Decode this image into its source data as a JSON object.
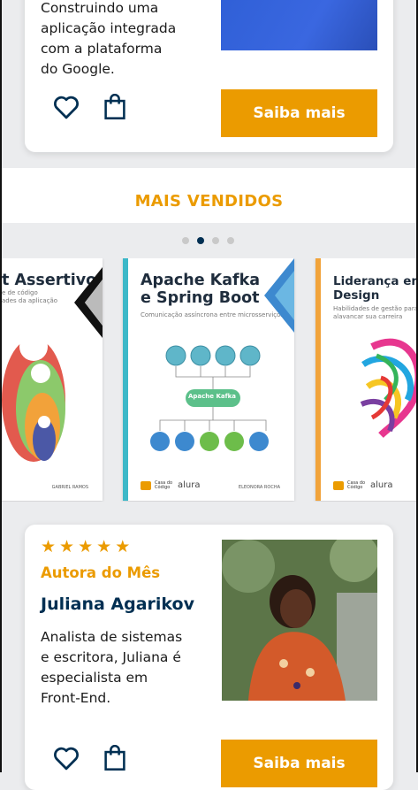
{
  "product_card": {
    "description": "Construindo uma\naplicação integrada\ncom a plataforma\ndo Google.",
    "buy_label": "Saiba mais",
    "favorite_icon": "heart-icon",
    "bag_icon": "shopping-bag-icon"
  },
  "best_sellers": {
    "title": "MAIS VENDIDOS",
    "dots_total": 4,
    "active_dot": 2,
    "books": [
      {
        "title": "t Assertivo",
        "subtitle": "e de código\nades da aplicação",
        "author": "GABRIEL RAMOS",
        "accent": "#e5e5e5"
      },
      {
        "title": "Apache Kafka\ne Spring Boot",
        "subtitle": "Comunicação assíncrona entre microsserviços",
        "diagram_label": "Apache Kafka",
        "publisher_1": "Casa do Código",
        "publisher_2": "alura",
        "author": "ELEONORA ROCHA",
        "accent": "#3cb8c8"
      },
      {
        "title": "Liderança em\nDesign",
        "subtitle": "Habilidades de gestão para\nalavancar sua carreira",
        "publisher_1": "Casa do Código",
        "publisher_2": "alura",
        "accent": "#f1a33a"
      }
    ]
  },
  "author_card": {
    "rating": 5,
    "label": "Autora do Mês",
    "name": "Juliana Agarikov",
    "description": "Analista de sistemas\ne escritora, Juliana é\nespecialista em\nFront-End.",
    "buy_label": "Saiba mais"
  },
  "colors": {
    "accent": "#eb9b00",
    "primary": "#002f52",
    "background": "#ebecee"
  }
}
